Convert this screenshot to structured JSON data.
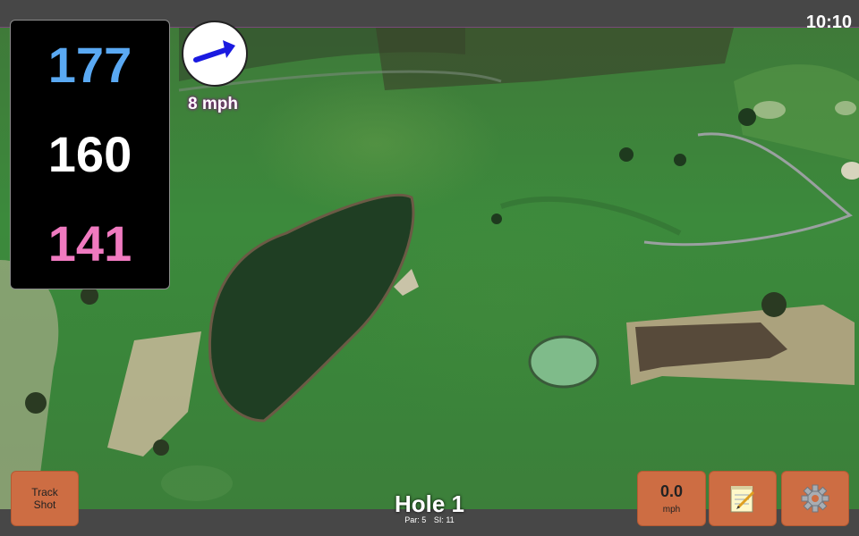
{
  "status": {
    "clock": "10:10"
  },
  "distances": {
    "back": {
      "value": "177",
      "color": "#5aa9f3"
    },
    "middle": {
      "value": "160",
      "color": "#ffffff"
    },
    "front": {
      "value": "141",
      "color": "#f07ac0"
    }
  },
  "wind": {
    "speed_label": "8 mph",
    "icon": "wind-direction-arrow-icon",
    "arrow_color": "#1a1ae0"
  },
  "track_shot": {
    "line1": "Track",
    "line2": "Shot"
  },
  "speed_button": {
    "value": "0.0",
    "unit": "mph"
  },
  "notes_button": {
    "icon": "notepad-icon"
  },
  "settings_button": {
    "icon": "gear-icon"
  },
  "hole": {
    "title": "Hole 1",
    "par": "Par: 5",
    "si": "SI: 11"
  },
  "colors": {
    "button": "#cd6d43",
    "bar": "#474747"
  }
}
